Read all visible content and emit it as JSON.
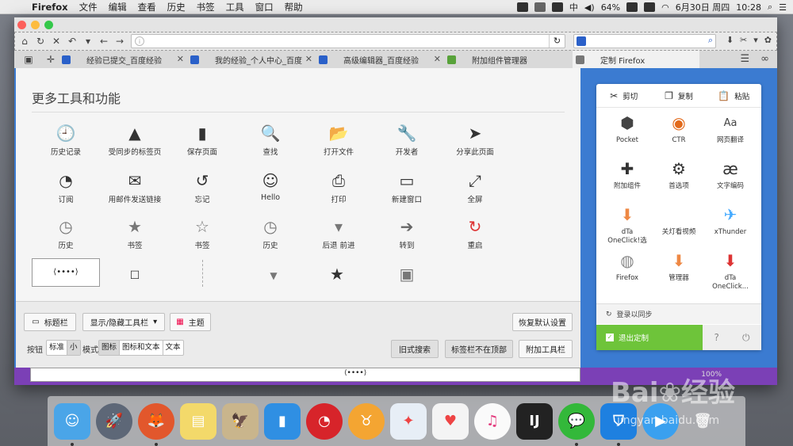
{
  "menubar": {
    "app": "Firefox",
    "items": [
      "文件",
      "编辑",
      "查看",
      "历史",
      "书签",
      "工具",
      "窗口",
      "帮助"
    ],
    "battery": "64%",
    "datetime": "6月30日 周四",
    "time": "10:28"
  },
  "tabs": [
    {
      "title": "经验已提交_百度经验",
      "fav": "baidu"
    },
    {
      "title": "我的经验_个人中心_百度经验",
      "fav": "baidu"
    },
    {
      "title": "高级编辑器_百度经验",
      "fav": "baidu"
    },
    {
      "title": "附加组件管理器",
      "fav": "puzzle"
    },
    {
      "title": "定制 Firefox",
      "fav": "gear",
      "active": true
    }
  ],
  "palette": {
    "title": "更多工具和功能",
    "items": [
      {
        "label": "历史记录",
        "icon": "clock-icon",
        "glyph": "🕘"
      },
      {
        "label": "受同步的标签页",
        "icon": "synced-tabs-icon",
        "glyph": "▲"
      },
      {
        "label": "保存页面",
        "icon": "save-page-icon",
        "glyph": "▮"
      },
      {
        "label": "查找",
        "icon": "search-icon",
        "glyph": "🔍"
      },
      {
        "label": "打开文件",
        "icon": "folder-icon",
        "glyph": "📂"
      },
      {
        "label": "开发者",
        "icon": "wrench-icon",
        "glyph": "🔧"
      },
      {
        "label": "分享此页面",
        "icon": "share-icon",
        "glyph": "➤"
      },
      {
        "label": "订阅",
        "icon": "rss-icon",
        "glyph": "◔"
      },
      {
        "label": "用邮件发送链接",
        "icon": "mail-icon",
        "glyph": "✉"
      },
      {
        "label": "忘记",
        "icon": "forget-icon",
        "glyph": "↺"
      },
      {
        "label": "Hello",
        "icon": "hello-icon",
        "glyph": "☺"
      },
      {
        "label": "打印",
        "icon": "print-icon",
        "glyph": "⎙"
      },
      {
        "label": "新建窗口",
        "icon": "new-window-icon",
        "glyph": "▭"
      },
      {
        "label": "全屏",
        "icon": "fullscreen-icon",
        "glyph": "⤢"
      },
      {
        "label": "历史",
        "icon": "history-icon",
        "glyph": "◷"
      },
      {
        "label": "书签",
        "icon": "bookmark-star-icon",
        "glyph": "★"
      },
      {
        "label": "书签",
        "icon": "bookmarks-toolbar-icon",
        "glyph": "☆"
      },
      {
        "label": "历史",
        "icon": "history-sidebar-icon",
        "glyph": "◷"
      },
      {
        "label": "后退 前进",
        "icon": "back-forward-icon",
        "glyph": "▾"
      },
      {
        "label": "转到",
        "icon": "go-arrow-icon",
        "glyph": "➔"
      },
      {
        "label": "重启",
        "icon": "restart-icon",
        "glyph": "↻"
      }
    ],
    "flex_space": "⟨••••⟩"
  },
  "bottom": {
    "titlebar": "标题栏",
    "toolbars": "显示/隐藏工具栏",
    "themes": "主题",
    "restore": "恢复默认设置",
    "buttons_label": "按钮",
    "size_options": [
      "标准",
      "小"
    ],
    "mode_label": "模式",
    "mode_options": [
      "图标",
      "图标和文本",
      "文本"
    ],
    "old_search": "旧式搜索",
    "tabs_not_top": "标签栏不在顶部",
    "add_toolbar": "附加工具栏"
  },
  "panel": {
    "cut": "剪切",
    "copy": "复制",
    "paste": "粘贴",
    "items": [
      {
        "label": "Pocket",
        "icon": "pocket-icon"
      },
      {
        "label": "CTR",
        "icon": "ctr-icon"
      },
      {
        "label": "网页翻译",
        "icon": "translate-icon"
      },
      {
        "label": "附加组件",
        "icon": "addons-icon"
      },
      {
        "label": "首选项",
        "icon": "preferences-icon"
      },
      {
        "label": "文字编码",
        "icon": "encoding-icon"
      },
      {
        "label": "dTa\nOneClick!选",
        "icon": "dta-icon"
      },
      {
        "label": "关灯看视频",
        "icon": "lights-off-icon"
      },
      {
        "label": "xThunder",
        "icon": "xthunder-icon"
      },
      {
        "label": "Firefox",
        "icon": "firefox-icon"
      },
      {
        "label": "管理器",
        "icon": "manager-icon"
      },
      {
        "label": "dTa OneClick...",
        "icon": "dta-oneclick-icon"
      }
    ],
    "sync": "登录以同步",
    "exit": "退出定制"
  },
  "statusbar": {
    "zoom": "100%"
  },
  "colors": {
    "accent_blue": "#3b7bd1",
    "exit_green": "#6ec43a",
    "status_purple": "#7b40b6"
  }
}
